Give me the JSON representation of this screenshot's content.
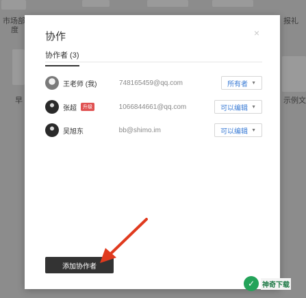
{
  "background": {
    "labels": [
      "市场部",
      "度",
      "早",
      "报礼",
      "示例文"
    ]
  },
  "modal": {
    "title": "协作",
    "close_glyph": "×",
    "tab_label": "协作者 (3)",
    "collaborators": [
      {
        "name": "王老师 (我)",
        "badge": "",
        "email": "748165459@qq.com",
        "role": "所有者"
      },
      {
        "name": "张超",
        "badge": "升级",
        "email": "1066844661@qq.com",
        "role": "可以编辑"
      },
      {
        "name": "吴旭东",
        "badge": "",
        "email": "bb@shimo.im",
        "role": "可以编辑"
      }
    ],
    "add_button": "添加协作者"
  },
  "watermark": {
    "text": "神奇下载"
  },
  "colors": {
    "accent": "#3a7bd5",
    "badge": "#e05252",
    "arrow": "#e03a1e",
    "button_dark": "#333333"
  }
}
